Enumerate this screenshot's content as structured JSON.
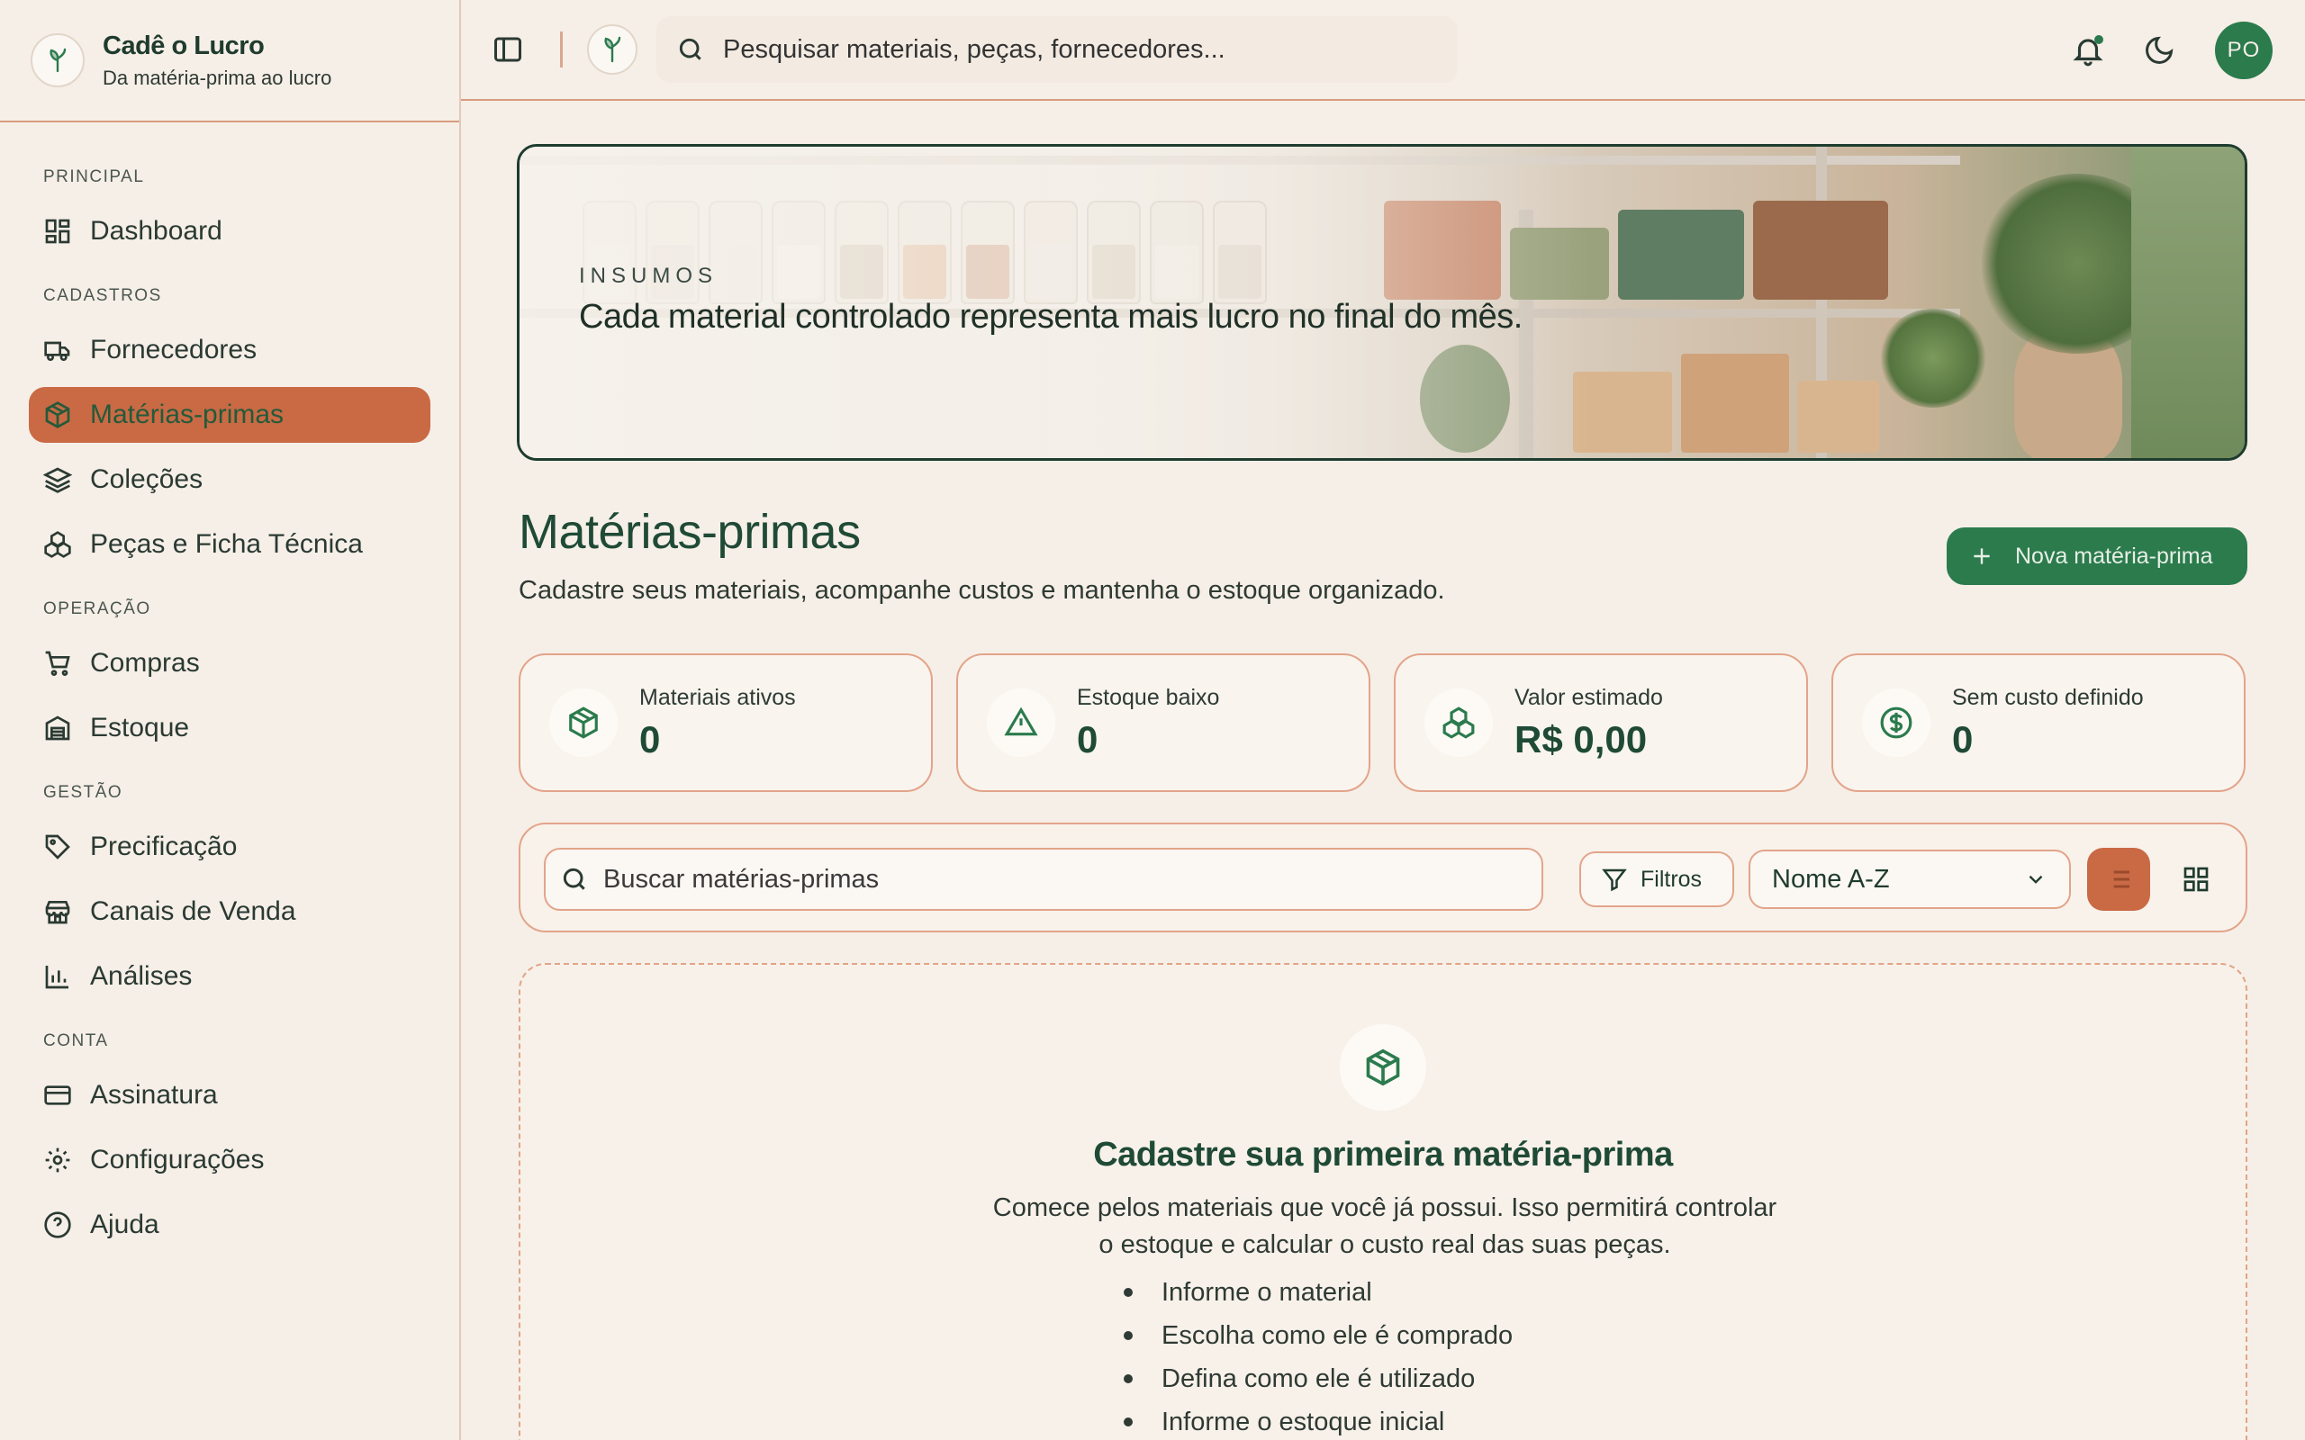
{
  "brand": {
    "name": "Cadê o Lucro",
    "tagline": "Da matéria-prima ao lucro"
  },
  "sidebar": {
    "sections": [
      {
        "label": "PRINCIPAL",
        "items": [
          {
            "label": "Dashboard",
            "icon": "dashboard-icon"
          }
        ]
      },
      {
        "label": "CADASTROS",
        "items": [
          {
            "label": "Fornecedores",
            "icon": "truck-icon"
          },
          {
            "label": "Matérias-primas",
            "icon": "package-icon",
            "active": true
          },
          {
            "label": "Coleções",
            "icon": "layers-icon"
          },
          {
            "label": "Peças e Ficha Técnica",
            "icon": "boxes-icon"
          }
        ]
      },
      {
        "label": "OPERAÇÃO",
        "items": [
          {
            "label": "Compras",
            "icon": "cart-icon"
          },
          {
            "label": "Estoque",
            "icon": "warehouse-icon"
          }
        ]
      },
      {
        "label": "GESTÃO",
        "items": [
          {
            "label": "Precificação",
            "icon": "tag-icon"
          },
          {
            "label": "Canais de Venda",
            "icon": "store-icon"
          },
          {
            "label": "Análises",
            "icon": "bar-chart-icon"
          }
        ]
      },
      {
        "label": "CONTA",
        "items": [
          {
            "label": "Assinatura",
            "icon": "credit-card-icon"
          },
          {
            "label": "Configurações",
            "icon": "gear-icon"
          },
          {
            "label": "Ajuda",
            "icon": "help-icon"
          }
        ]
      }
    ]
  },
  "topbar": {
    "search_placeholder": "Pesquisar materiais, peças, fornecedores...",
    "avatar_initials": "PO"
  },
  "hero": {
    "eyebrow": "INSUMOS",
    "headline": "Cada material controlado representa mais lucro no final do mês."
  },
  "page": {
    "title": "Matérias-primas",
    "subtitle": "Cadastre seus materiais, acompanhe custos e mantenha o estoque organizado.",
    "new_button": "Nova matéria-prima"
  },
  "stats": [
    {
      "label": "Materiais ativos",
      "value": "0",
      "icon": "package-icon"
    },
    {
      "label": "Estoque baixo",
      "value": "0",
      "icon": "alert-triangle-icon"
    },
    {
      "label": "Valor estimado",
      "value": "R$ 0,00",
      "icon": "boxes-icon"
    },
    {
      "label": "Sem custo definido",
      "value": "0",
      "icon": "dollar-circle-icon"
    }
  ],
  "toolbar": {
    "search_placeholder": "Buscar matérias-primas",
    "filter_label": "Filtros",
    "sort_value": "Nome A-Z"
  },
  "empty_state": {
    "title": "Cadastre sua primeira matéria-prima",
    "line1": "Comece pelos materiais que você já possui. Isso permitirá controlar",
    "line2": "o estoque e calcular o custo real das suas peças.",
    "steps": [
      "Informe o material",
      "Escolha como ele é comprado",
      "Defina como ele é utilizado",
      "Informe o estoque inicial"
    ]
  },
  "colors": {
    "accent": "#c96a45",
    "brand_green": "#2b7b4d",
    "background": "#f6efe7",
    "border": "#e3a48a"
  }
}
